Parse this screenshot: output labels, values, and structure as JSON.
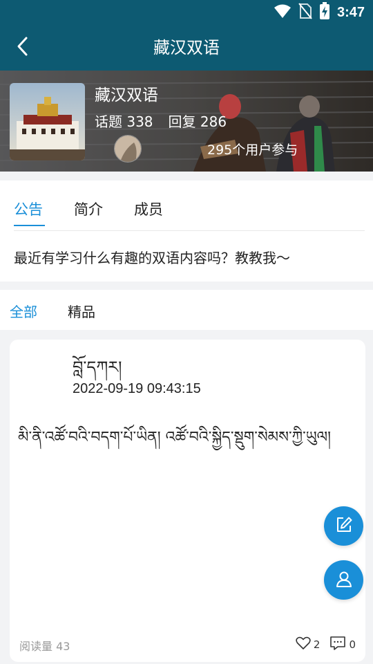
{
  "status": {
    "time": "3:47",
    "icons": [
      "wifi-icon",
      "no-sim-icon",
      "battery-charging-icon"
    ]
  },
  "appbar": {
    "title": "藏汉双语",
    "back_icon": "chevron-left-icon"
  },
  "group": {
    "name": "藏汉双语",
    "topics": "话题 338",
    "replies": "回复 286",
    "participants": "295个用户参与"
  },
  "info_tabs": {
    "announcement": "公告",
    "intro": "简介",
    "members": "成员",
    "active": "公告"
  },
  "announcement_text": "最近有学习什么有趣的双语内容吗？教教我～",
  "filter_tabs": {
    "all": "全部",
    "featured": "精品",
    "active": "全部"
  },
  "post": {
    "author": "བློ་དཀར།",
    "time": "2022-09-19 09:43:15",
    "content": "མི་ནི་འཚོ་བའི་བདག་པོ་ཡིན། འཚོ་བའི་སྐྱིད་སྡུག་སེམས་ཀྱི་ཡུལ།",
    "views": "阅读量 43",
    "likes": "2",
    "comments": "0"
  },
  "fabs": [
    "compose-icon",
    "user-icon"
  ],
  "colors": {
    "header": "#0d5a72",
    "accent": "#1a8fd8",
    "background": "#f2f3f5"
  }
}
